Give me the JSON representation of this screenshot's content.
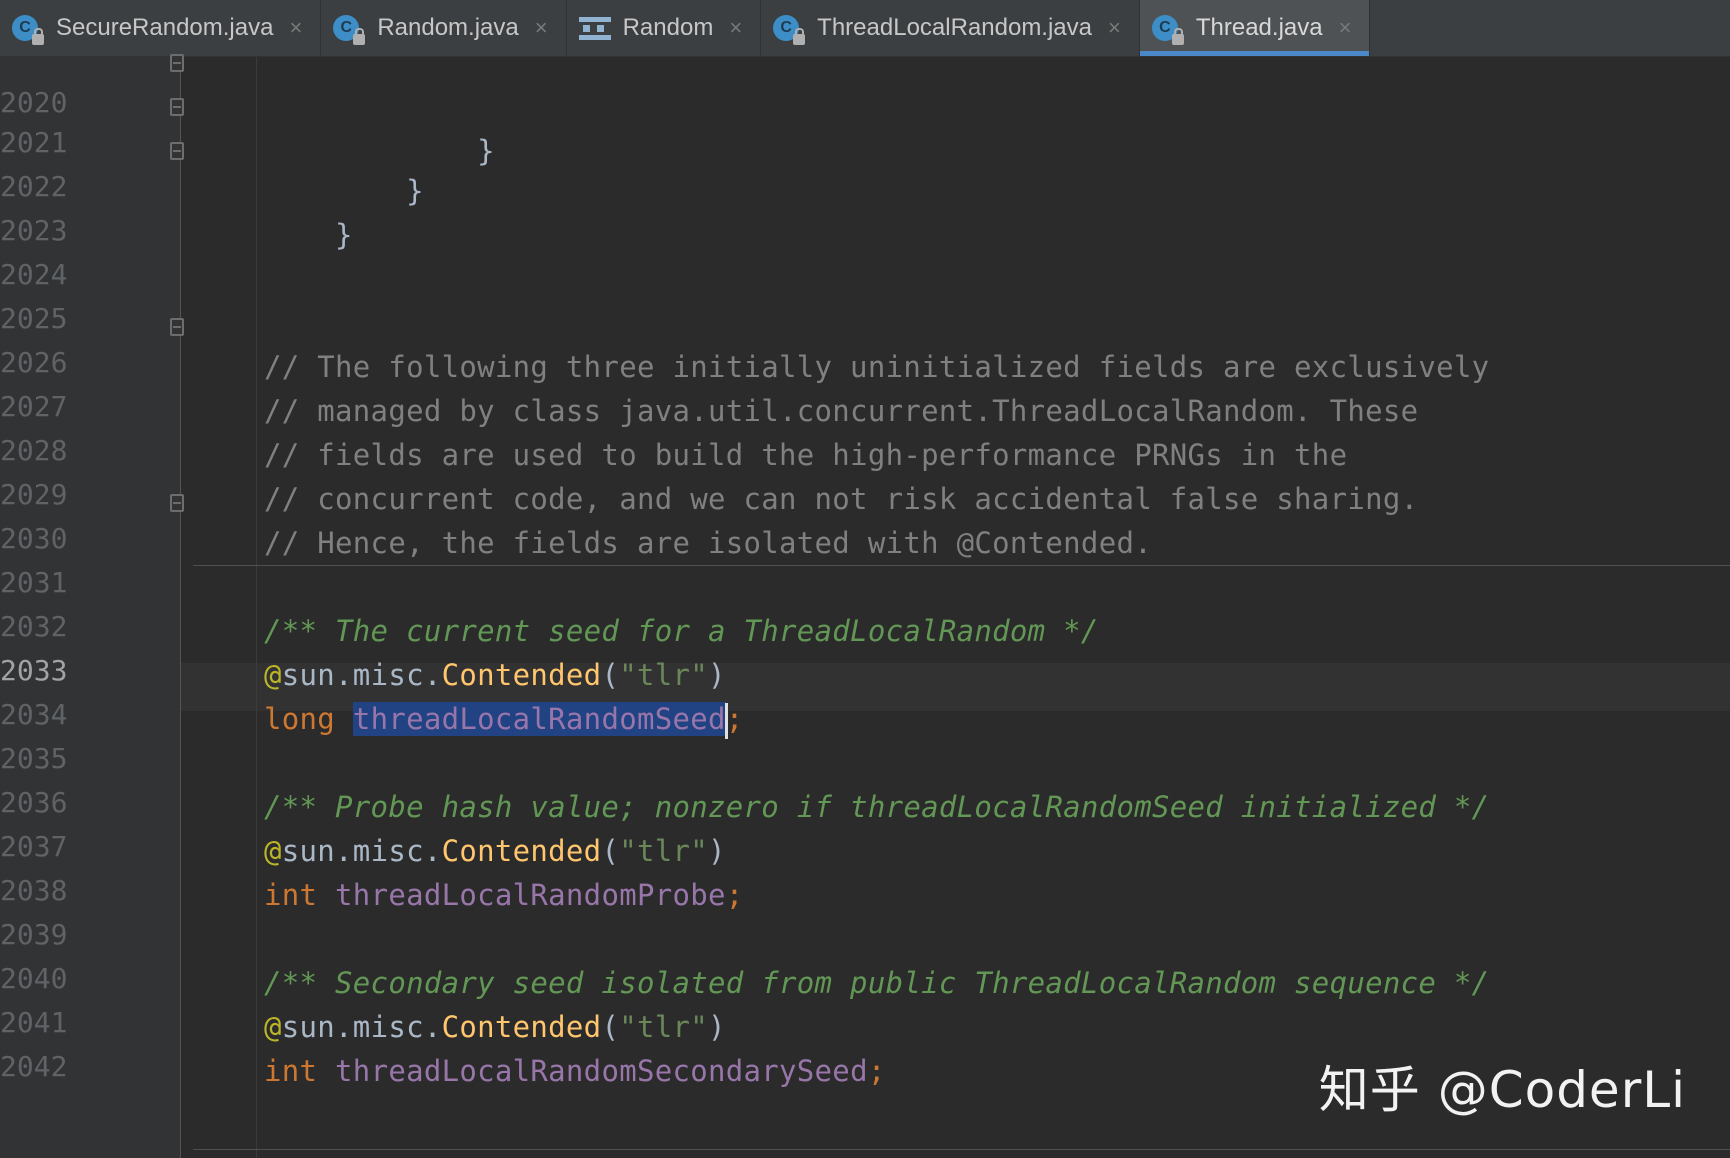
{
  "tabs": [
    {
      "label": "SecureRandom.java",
      "icon": "class-icon",
      "active": false
    },
    {
      "label": "Random.java",
      "icon": "class-icon",
      "active": false
    },
    {
      "label": "Random",
      "icon": "structure-icon",
      "active": false
    },
    {
      "label": "ThreadLocalRandom.java",
      "icon": "class-icon",
      "active": false
    },
    {
      "label": "Thread.java",
      "icon": "class-icon",
      "active": true
    }
  ],
  "tab_close_glyph": "×",
  "class_icon_letter": "C",
  "lines": [
    {
      "num": "2020",
      "text": "            }"
    },
    {
      "num": "2021",
      "text": "        }"
    },
    {
      "num": "2022",
      "text": "    }"
    },
    {
      "num": "2023",
      "text": ""
    },
    {
      "num": "2024",
      "text": ""
    },
    {
      "num": "2025",
      "text": "// The following three initially uninitialized fields are exclusively"
    },
    {
      "num": "2026",
      "text": "// managed by class java.util.concurrent.ThreadLocalRandom. These"
    },
    {
      "num": "2027",
      "text": "// fields are used to build the high-performance PRNGs in the"
    },
    {
      "num": "2028",
      "text": "// concurrent code, and we can not risk accidental false sharing."
    },
    {
      "num": "2029",
      "text": "// Hence, the fields are isolated with @Contended."
    },
    {
      "num": "2030",
      "text": ""
    },
    {
      "num": "2031",
      "text": "/** The current seed for a ThreadLocalRandom */"
    },
    {
      "num": "2032",
      "anno": "@",
      "pkg": "sun.misc.",
      "method": "Contended",
      "open": "(",
      "str": "\"tlr\"",
      "close": ")"
    },
    {
      "num": "2033",
      "kw": "long",
      "field": "threadLocalRandomSeed",
      "semi": ";"
    },
    {
      "num": "2034",
      "text": ""
    },
    {
      "num": "2035",
      "text": "/** Probe hash value; nonzero if threadLocalRandomSeed initialized */"
    },
    {
      "num": "2036",
      "anno": "@",
      "pkg": "sun.misc.",
      "method": "Contended",
      "open": "(",
      "str": "\"tlr\"",
      "close": ")"
    },
    {
      "num": "2037",
      "kw": "int",
      "field": "threadLocalRandomProbe",
      "semi": ";"
    },
    {
      "num": "2038",
      "text": ""
    },
    {
      "num": "2039",
      "text": "/** Secondary seed isolated from public ThreadLocalRandom sequence */"
    },
    {
      "num": "2040",
      "anno": "@",
      "pkg": "sun.misc.",
      "method": "Contended",
      "open": "(",
      "str": "\"tlr\"",
      "close": ")"
    },
    {
      "num": "2041",
      "kw": "int",
      "field": "threadLocalRandomSecondarySeed",
      "semi": ";"
    },
    {
      "num": "2042",
      "text": ""
    }
  ],
  "current_line": "2033",
  "watermark": "知乎 @CoderLi",
  "colors": {
    "comment": "#808080",
    "doc_comment": "#629755",
    "keyword": "#cc7832",
    "annotation": "#bbb529",
    "method": "#ffc66d",
    "string": "#6a8759",
    "field": "#9876aa",
    "selection": "#214283",
    "active_tab_underline": "#4a88c7"
  }
}
